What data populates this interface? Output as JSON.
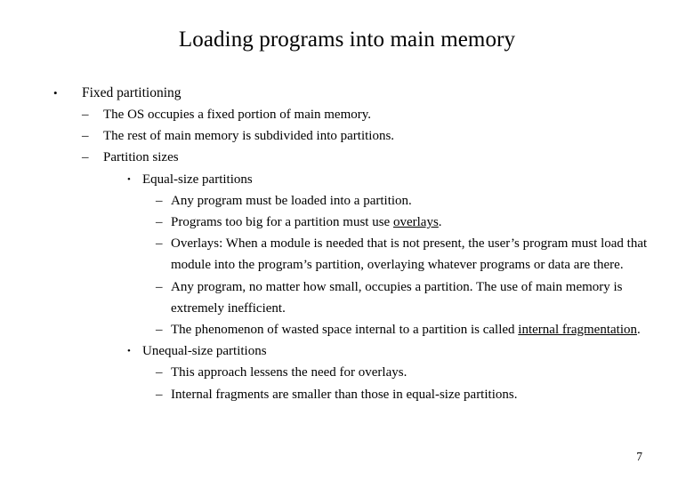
{
  "slide": {
    "title": "Loading programs into main memory",
    "page_number": "7",
    "bullet_markers": {
      "level1": "•",
      "level2": "–",
      "level3": "•",
      "level4": "–"
    },
    "content": [
      {
        "level": 1,
        "marker": "•",
        "text": "Fixed partitioning"
      },
      {
        "level": 2,
        "marker": "–",
        "text": "The OS occupies a fixed portion of main memory."
      },
      {
        "level": 2,
        "marker": "–",
        "text": "The rest of main memory is subdivided into partitions."
      },
      {
        "level": 2,
        "marker": "–",
        "text": "Partition sizes"
      },
      {
        "level": 3,
        "marker": "•",
        "text": "Equal-size partitions"
      },
      {
        "level": 4,
        "marker": "–",
        "text": "Any program must be loaded into a partition."
      },
      {
        "level": 4,
        "marker": "–",
        "text_before": "Programs too big for a partition must use ",
        "text_underlined": "overlays",
        "text_after": ".",
        "text": "Programs too big for a partition must use overlays."
      },
      {
        "level": 4,
        "marker": "–",
        "text": "Overlays: When a module is needed that is not present, the user’s program must load that module into the program’s partition, overlaying whatever programs or data are there."
      },
      {
        "level": 4,
        "marker": "–",
        "text": "Any program, no matter how small, occupies a partition.  The use of main memory is extremely inefficient."
      },
      {
        "level": 4,
        "marker": "–",
        "text_before": "The phenomenon of wasted space internal to a partition is called ",
        "text_underlined": "internal fragmentation",
        "text_after": ".",
        "text": "The phenomenon of wasted space internal to a partition is called internal fragmentation."
      },
      {
        "level": 3,
        "marker": "•",
        "text": "Unequal-size partitions"
      },
      {
        "level": 4,
        "marker": "–",
        "text": "This approach lessens the need for overlays."
      },
      {
        "level": 4,
        "marker": "–",
        "text": "Internal fragments are smaller than those in equal-size partitions."
      }
    ]
  }
}
